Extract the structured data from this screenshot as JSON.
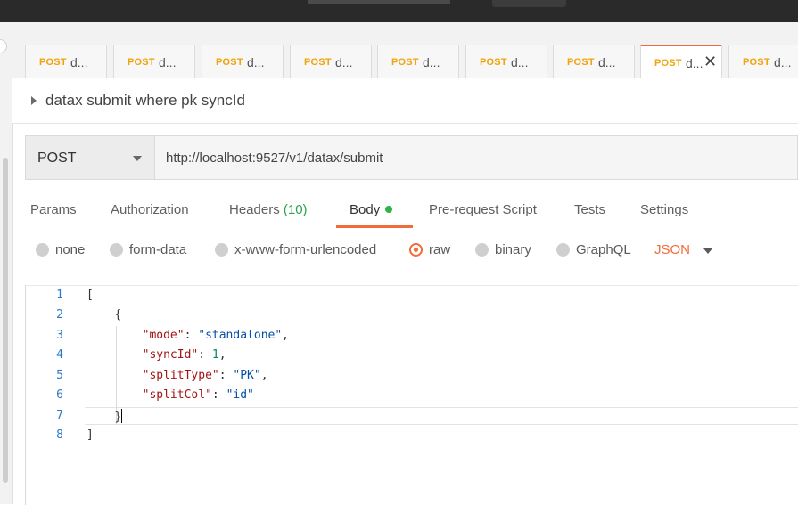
{
  "tabs": [
    {
      "method": "POST",
      "name": "d..."
    },
    {
      "method": "POST",
      "name": "d..."
    },
    {
      "method": "POST",
      "name": "d..."
    },
    {
      "method": "POST",
      "name": "d..."
    },
    {
      "method": "POST",
      "name": "d..."
    },
    {
      "method": "POST",
      "name": "d..."
    },
    {
      "method": "POST",
      "name": "d..."
    },
    {
      "method": "POST",
      "name": "d...",
      "close": "✕"
    },
    {
      "method": "POST",
      "name": "d..."
    }
  ],
  "request": {
    "title": "datax submit where pk syncId",
    "method": "POST",
    "url": "http://localhost:9527/v1/datax/submit"
  },
  "request_tabs": {
    "params": "Params",
    "authorization": "Authorization",
    "headers": "Headers",
    "headers_count": "(10)",
    "body": "Body",
    "prerequest": "Pre-request Script",
    "tests": "Tests",
    "settings": "Settings"
  },
  "body_types": {
    "none": "none",
    "form_data": "form-data",
    "urlencoded": "x-www-form-urlencoded",
    "raw": "raw",
    "binary": "binary",
    "graphql": "GraphQL",
    "language": "JSON",
    "selected": "raw"
  },
  "editor": {
    "line_numbers": [
      "1",
      "2",
      "3",
      "4",
      "5",
      "6",
      "7",
      "8"
    ],
    "l1": "[",
    "l2": "{",
    "l3_key": "\"mode\"",
    "l3_val": "\"standalone\"",
    "l4_key": "\"syncId\"",
    "l4_val": "1",
    "l5_key": "\"splitType\"",
    "l5_val": "\"PK\"",
    "l6_key": "\"splitCol\"",
    "l6_val": "\"id\"",
    "l7": "}",
    "l8": "]"
  },
  "colors": {
    "accent": "#f26b3a",
    "method_tab": "#f0a30a",
    "success": "#2fb344"
  }
}
